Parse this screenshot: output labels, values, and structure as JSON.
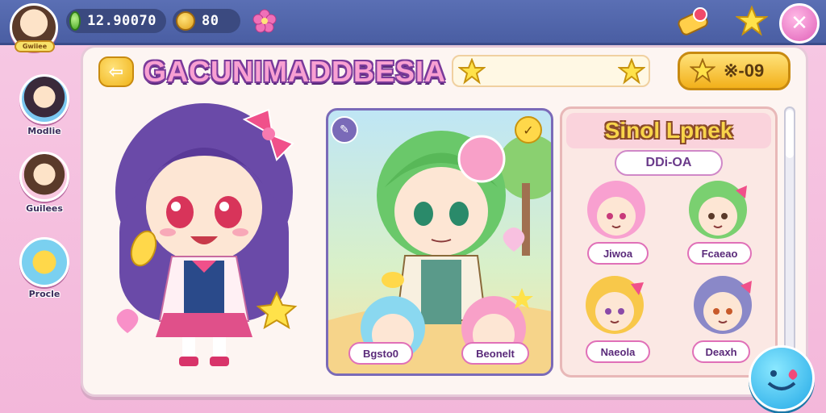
{
  "topbar": {
    "avatar_badge": "Gwiiee",
    "gems": "12.90070",
    "coins": "80"
  },
  "sidebar": {
    "items": [
      {
        "label": "Modlie"
      },
      {
        "label": "Guilees"
      },
      {
        "label": "Procle"
      }
    ]
  },
  "main": {
    "title": "GACUNIMADDBESIA",
    "reward_value": "※-09"
  },
  "feature": {
    "names": [
      "Bgsto0",
      "Beonelt"
    ]
  },
  "roster": {
    "title": "Sinol Lpnek",
    "subtitle": "DDi-OA",
    "characters": [
      {
        "name": "Jiwoa"
      },
      {
        "name": "Fcaeao"
      },
      {
        "name": "Naeola"
      },
      {
        "name": "Deaxh"
      }
    ]
  },
  "colors": {
    "topbar": "#4a5ea3",
    "panel": "#fdf5f2",
    "pink": "#f3b7da",
    "gold": "#f2b01a",
    "purple": "#7a3a9a"
  },
  "icons": [
    "avatar-icon",
    "gem-icon",
    "coin-icon",
    "flower-icon",
    "ticket-icon",
    "star-icon",
    "close-icon",
    "back-arrow-icon",
    "chat-bubble-icon",
    "check-icon",
    "tag-icon"
  ]
}
